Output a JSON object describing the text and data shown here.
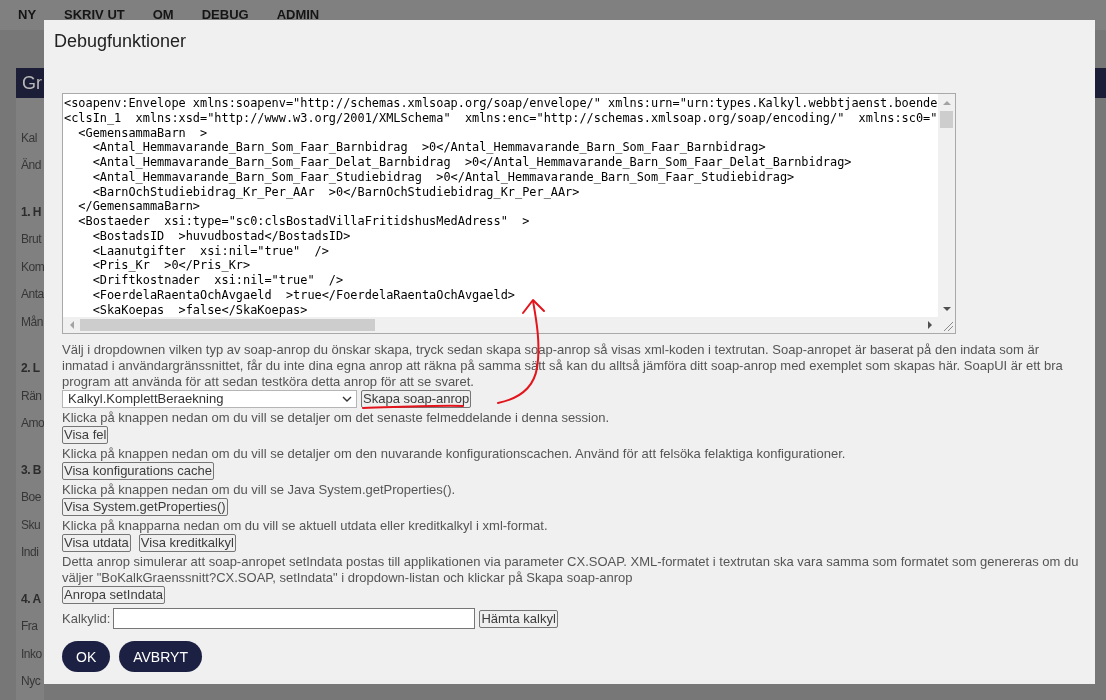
{
  "menu": [
    "NY",
    "SKRIV UT",
    "OM",
    "DEBUG",
    "ADMIN"
  ],
  "sidebar": {
    "title": "Gr",
    "items": [
      {
        "kind": "link",
        "label": "Kal"
      },
      {
        "kind": "link",
        "label": "Änd"
      },
      {
        "kind": "heading",
        "label": "1. H"
      },
      {
        "kind": "link",
        "label": "Brut"
      },
      {
        "kind": "link",
        "label": "Kom"
      },
      {
        "kind": "link",
        "label": "Anta"
      },
      {
        "kind": "link",
        "label": "Mån"
      },
      {
        "kind": "heading",
        "label": "2. L"
      },
      {
        "kind": "link",
        "label": "Rän"
      },
      {
        "kind": "link",
        "label": "Amo"
      },
      {
        "kind": "heading",
        "label": "3. B"
      },
      {
        "kind": "link",
        "label": "Boe"
      },
      {
        "kind": "link",
        "label": "Sku"
      },
      {
        "kind": "link",
        "label": "Indi"
      },
      {
        "kind": "heading",
        "label": "4. A"
      },
      {
        "kind": "link",
        "label": "Fra"
      },
      {
        "kind": "link",
        "label": "Inko"
      },
      {
        "kind": "link",
        "label": "Nyc"
      }
    ]
  },
  "dialog": {
    "title": "Debugfunktioner",
    "xml_lines": [
      "<soapenv:Envelope xmlns:soapenv=\"http://schemas.xmlsoap.org/soap/envelope/\" xmlns:urn=\"urn:types.Kalkyl.webbtjaenst.boende",
      "<clsIn_1  xmlns:xsd=\"http://www.w3.org/2001/XMLSchema\"  xmlns:enc=\"http://schemas.xmlsoap.org/soap/encoding/\"  xmlns:sc0=\"",
      "  <GemensammaBarn  >",
      "    <Antal_Hemmavarande_Barn_Som_Faar_Barnbidrag  >0</Antal_Hemmavarande_Barn_Som_Faar_Barnbidrag>",
      "    <Antal_Hemmavarande_Barn_Som_Faar_Delat_Barnbidrag  >0</Antal_Hemmavarande_Barn_Som_Faar_Delat_Barnbidrag>",
      "    <Antal_Hemmavarande_Barn_Som_Faar_Studiebidrag  >0</Antal_Hemmavarande_Barn_Som_Faar_Studiebidrag>",
      "    <BarnOchStudiebidrag_Kr_Per_AAr  >0</BarnOchStudiebidrag_Kr_Per_AAr>",
      "  </GemensammaBarn>",
      "  <Bostaeder  xsi:type=\"sc0:clsBostadVillaFritidshusMedAdress\"  >",
      "    <BostadsID  >huvudbostad</BostadsID>",
      "    <Laanutgifter  xsi:nil=\"true\"  />",
      "    <Pris_Kr  >0</Pris_Kr>",
      "    <Driftkostnader  xsi:nil=\"true\"  />",
      "    <FoerdelaRaentaOchAvgaeld  >true</FoerdelaRaentaOchAvgaeld>",
      "    <SkaKoepas  >false</SkaKoepas>"
    ],
    "sections": [
      {
        "text": "Välj i dropdownen vilken typ av soap-anrop du önskar skapa, tryck sedan skapa soap-anrop så visas xml-koden i textrutan. Soap-anropet är baserat på den indata som är inmatad i användargränssnittet, får du inte dina egna anrop att räkna på samma sätt så kan du alltså jämföra ditt soap-anrop med exemplet som skapas här. SoapUI är ett bra program att använda för att sedan testköra detta anrop för att se svaret.",
        "controls": [
          {
            "kind": "select",
            "value": "Kalkyl.KomplettBeraekning"
          },
          {
            "kind": "button",
            "label": "Skapa soap-anrop"
          }
        ]
      },
      {
        "text": "Klicka på knappen nedan om du vill se detaljer om det senaste felmeddelande i denna session.",
        "controls": [
          {
            "kind": "button",
            "label": "Visa fel"
          }
        ]
      },
      {
        "text": "Klicka på knappen nedan om du vill se detaljer om den nuvarande konfigurationscachen. Använd för att felsöka felaktiga konfigurationer.",
        "controls": [
          {
            "kind": "button",
            "label": "Visa konfigurations cache"
          }
        ]
      },
      {
        "text": "Klicka på knappen nedan om du vill se Java System.getProperties().",
        "controls": [
          {
            "kind": "button",
            "label": "Visa System.getProperties()"
          }
        ]
      },
      {
        "text": "Klicka på knapparna nedan om du vill se aktuell utdata eller kreditkalkyl i xml-format.",
        "controls": [
          {
            "kind": "button",
            "label": "Visa utdata"
          },
          {
            "kind": "button",
            "label": "Visa kreditkalkyl"
          }
        ]
      },
      {
        "text": "Detta anrop simulerar att soap-anropet setIndata postas till applikationen via parameter CX.SOAP. XML-formatet i textrutan ska vara samma som formatet som genereras om du väljer \"BoKalkGraenssnitt?CX.SOAP, setIndata\" i dropdown-listan och klickar på Skapa soap-anrop",
        "controls": [
          {
            "kind": "button",
            "label": "Anropa setIndata"
          }
        ]
      }
    ],
    "lookup": {
      "label": "Kalkylid:",
      "button": "Hämta kalkyl"
    },
    "actions": [
      "OK",
      "AVBRYT"
    ]
  }
}
